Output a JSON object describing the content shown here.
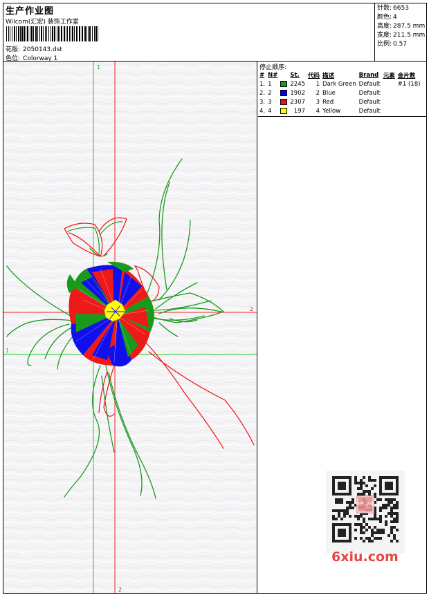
{
  "header": {
    "title": "生产作业图",
    "company": "Wilcom(汇宏) 装饰工作室",
    "design_label": "花版:",
    "design_value": "2050143.dst",
    "colorway_label": "色位:",
    "colorway_value": "Colorway 1"
  },
  "stats": [
    {
      "label": "针数:",
      "value": "6653"
    },
    {
      "label": "颜色:",
      "value": "4"
    },
    {
      "label": "高度:",
      "value": "287.5 mm"
    },
    {
      "label": "宽度:",
      "value": "211.5 mm"
    },
    {
      "label": "比例:",
      "value": "0.57"
    }
  ],
  "stop_sequence": {
    "title": "停止顺序:",
    "columns": [
      "#",
      "N#",
      "St.",
      "代码",
      "描述",
      "Brand",
      "元素",
      "金片数"
    ],
    "rows": [
      {
        "idx": "1.",
        "needle": "1",
        "color": "#1a9a1a",
        "stitches": "2245",
        "code": "1",
        "desc": "Dark Green",
        "brand": "Default",
        "elements": "",
        "sequins": "#1 (18)"
      },
      {
        "idx": "2.",
        "needle": "2",
        "color": "#0000ee",
        "stitches": "1902",
        "code": "2",
        "desc": "Blue",
        "brand": "Default",
        "elements": "",
        "sequins": ""
      },
      {
        "idx": "3.",
        "needle": "3",
        "color": "#ee1111",
        "stitches": "2307",
        "code": "3",
        "desc": "Red",
        "brand": "Default",
        "elements": "",
        "sequins": ""
      },
      {
        "idx": "4.",
        "needle": "4",
        "color": "#ffff00",
        "stitches": "197",
        "code": "4",
        "desc": "Yellow",
        "brand": "Default",
        "elements": "",
        "sequins": ""
      }
    ]
  },
  "canvas": {
    "axis_green_label_top": "1",
    "axis_green_label_left": "1",
    "axis_red_label_right": "2",
    "axis_red_label_bottom": "2",
    "colors": {
      "green_axis": "#22cc22",
      "red_axis": "#ee2222"
    }
  },
  "watermark": {
    "text": "6xiu.com",
    "stamp_text": "图片 水印"
  }
}
